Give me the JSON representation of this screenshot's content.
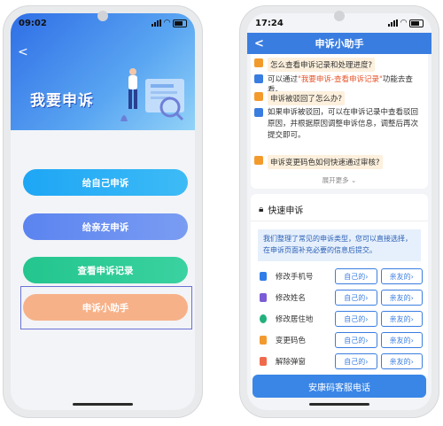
{
  "left_screen": {
    "status": {
      "time": "09:02"
    },
    "back_symbol": "<",
    "banner_title": "我要申诉",
    "buttons": [
      {
        "label": "给自己申诉",
        "color": "#1ea6f5"
      },
      {
        "label": "给亲友申诉",
        "color": "#5b84f0"
      },
      {
        "label": "查看申诉记录",
        "color": "#24c58e"
      },
      {
        "label": "申诉小助手",
        "color": "#f7b188"
      }
    ]
  },
  "right_screen": {
    "status": {
      "time": "17:24"
    },
    "nav": {
      "back_symbol": "<",
      "title": "申诉小助手"
    },
    "faq": {
      "q1": "怎么查看申诉记录和处理进度?",
      "a1_prefix": "可以通过",
      "a1_link": "\"我要申诉-查看申诉记录\"",
      "a1_suffix": "功能去查看。",
      "q2": "申诉被驳回了怎么办?",
      "a2": "如果申诉被驳回，可以在申诉记录中查看驳回原因，并根据原因调整申诉信息，调整后再次提交即可。",
      "q3": "申诉变更码色如何快速通过审核?",
      "more": "展开更多"
    },
    "quick": {
      "title": "快速申诉",
      "notice": "我们整理了常见的申诉类型，您可以直接选择，在申诉页面补充必要的信息后提交。",
      "items": [
        {
          "label": "修改手机号",
          "self": "自己的",
          "family": "亲友的",
          "icon": "phone-icon",
          "color": "#2f7de8"
        },
        {
          "label": "修改姓名",
          "self": "自己的",
          "family": "亲友的",
          "icon": "person-icon",
          "color": "#7b5cd6"
        },
        {
          "label": "修改居住地",
          "self": "自己的",
          "family": "亲友的",
          "icon": "location-icon",
          "color": "#22b07d"
        },
        {
          "label": "变更码色",
          "self": "自己的",
          "family": "亲友的",
          "icon": "code-color-icon",
          "color": "#f29a2e"
        },
        {
          "label": "解除弹窗",
          "self": "自己的",
          "family": "亲友的",
          "icon": "popup-icon",
          "color": "#ef6a4c"
        }
      ]
    },
    "hotline": "安康码客服电话"
  }
}
